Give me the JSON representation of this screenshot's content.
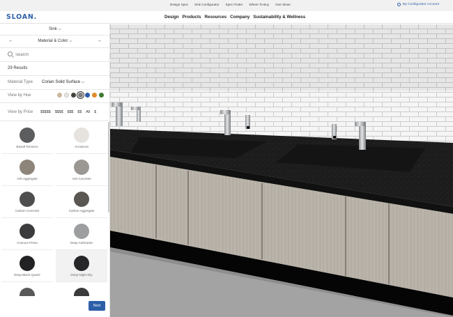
{
  "utility": {
    "links": [
      "Design Spec",
      "Sink Configurator",
      "Spec Finder",
      "Where To Buy",
      "One Sloan"
    ],
    "account": "My Configurator Account"
  },
  "nav": {
    "logo": "SLOAN.",
    "links": [
      "Design",
      "Products",
      "Resources",
      "Company",
      "Sustainability & Wellness"
    ]
  },
  "sidebar": {
    "product": "Sink",
    "step": "Material & Color",
    "search_placeholder": "Search",
    "results": "29 Results",
    "material_type_label": "Material Type",
    "material_type_value": "Corian Solid Surface",
    "hue_label": "View by Hue",
    "hues": [
      "#cbb89b",
      "#e9e5dc",
      "#45413d",
      "#7c7c7c",
      "#2a5aa8",
      "#e08a2c",
      "#3d7a33"
    ],
    "price_label": "View by Price",
    "price_tiers": [
      "$$$$$",
      "$$$$",
      "$$$",
      "$$",
      "All",
      "$"
    ],
    "materials": [
      {
        "name": "Basalt Terrazzo",
        "color": "#5c5d5f"
      },
      {
        "name": "Arrowroot",
        "color": "#e6e3de"
      },
      {
        "name": "Ash Aggregate",
        "color": "#8d857a"
      },
      {
        "name": "Ash Concrete",
        "color": "#9b9894"
      },
      {
        "name": "Carbon Concrete",
        "color": "#4e4e4f"
      },
      {
        "name": "Carbon Aggregate",
        "color": "#5a5753"
      },
      {
        "name": "Cosmos Prima",
        "color": "#3b3b3d"
      },
      {
        "name": "Deep Anthracite",
        "color": "#9c9ea0"
      },
      {
        "name": "Deep Black Quartz",
        "color": "#222224"
      },
      {
        "name": "Deep Night Sky",
        "color": "#262628"
      },
      {
        "name": "",
        "color": "#595959"
      },
      {
        "name": "",
        "color": "#3a3a3a"
      }
    ],
    "next_label": "Next"
  }
}
